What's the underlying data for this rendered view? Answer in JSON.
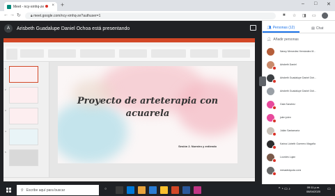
{
  "browser": {
    "tab_title": "Meet - ncy-xmhq-ze",
    "url": "meet.google.com/ncy-xmhq-ze?authuser=1"
  },
  "meet": {
    "presenter_initial": "A",
    "presenting_text": "Arisbeth Guadalupe Daniel Ochoa está presentando"
  },
  "slide": {
    "title_line1": "Proyecto de arteterapia con",
    "title_line2": "acuarela",
    "subtitle": "Sesión 2. Nuestro y entiendo"
  },
  "panel": {
    "tab_people": "Personas (12)",
    "tab_chat": "Chat",
    "add_people": "Añadir personas",
    "participants": [
      {
        "name": "Nancy Mercedes Hernández M...",
        "color": "#b55e3a"
      },
      {
        "name": "Arisbeth Daniel",
        "color": "#c98a6b"
      },
      {
        "name": "Arisbeth Guadalupe Daniel Och...",
        "color": "#3c4043"
      },
      {
        "name": "Arisbeth Guadalupe Daniel Och...",
        "color": "#9aa0a6"
      },
      {
        "name": "Gala Sanchez",
        "color": "#e84a9c"
      },
      {
        "name": "julen julen",
        "color": "#e84a9c"
      },
      {
        "name": "Julián Santamaría",
        "color": "#c9c1b8"
      },
      {
        "name": "Karina Lizbeth Guerrero Magaña",
        "color": "#2d2d2d"
      },
      {
        "name": "Lourdes Lujan",
        "color": "#7a5a4a"
      },
      {
        "name": "mesadeayuda.cons",
        "color": "#6a6a6a"
      }
    ]
  },
  "taskbar": {
    "search_placeholder": "Escribe aquí para buscar",
    "time": "09:11 p.m.",
    "date": "08/04/2020"
  }
}
